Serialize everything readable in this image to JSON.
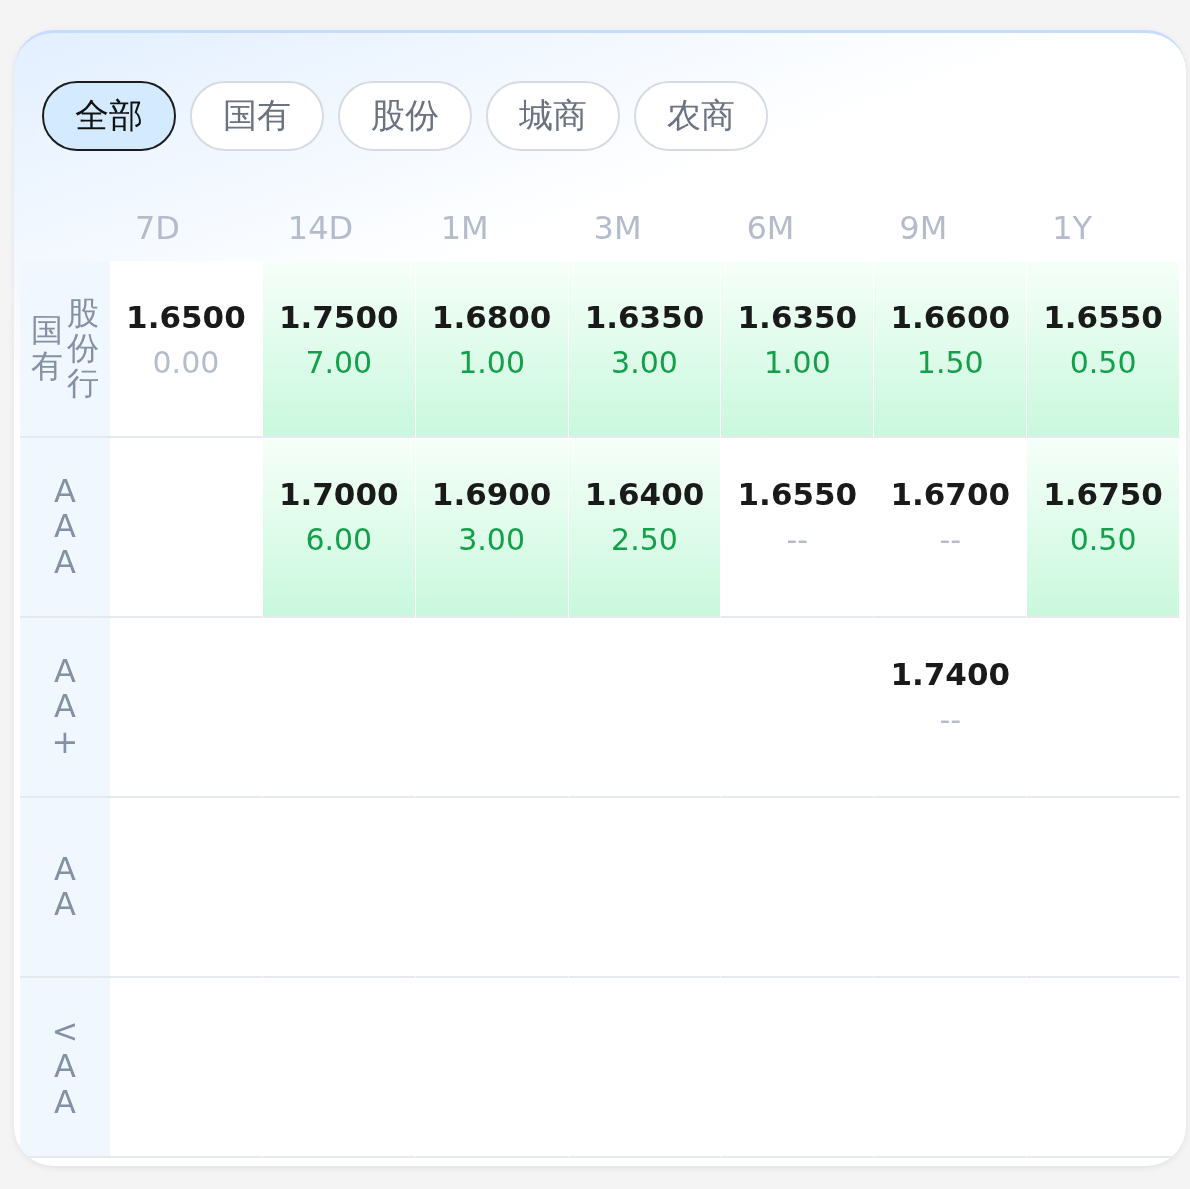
{
  "tabs": [
    {
      "label": "全部",
      "selected": true
    },
    {
      "label": "国有",
      "selected": false
    },
    {
      "label": "股份",
      "selected": false
    },
    {
      "label": "城商",
      "selected": false
    },
    {
      "label": "农商",
      "selected": false
    }
  ],
  "columns": [
    "7D",
    "14D",
    "1M",
    "3M",
    "6M",
    "9M",
    "1Y"
  ],
  "rows": [
    {
      "label": [
        "国有",
        "股份行"
      ],
      "cells": [
        {
          "value": "1.6500",
          "change": "0.00",
          "rising": false,
          "highlighted": false
        },
        {
          "value": "1.7500",
          "change": "7.00",
          "rising": true,
          "highlighted": true
        },
        {
          "value": "1.6800",
          "change": "1.00",
          "rising": true,
          "highlighted": true
        },
        {
          "value": "1.6350",
          "change": "3.00",
          "rising": true,
          "highlighted": true
        },
        {
          "value": "1.6350",
          "change": "1.00",
          "rising": true,
          "highlighted": true
        },
        {
          "value": "1.6600",
          "change": "1.50",
          "rising": true,
          "highlighted": true
        },
        {
          "value": "1.6550",
          "change": "0.50",
          "rising": true,
          "highlighted": true
        }
      ]
    },
    {
      "label": [
        "AAA"
      ],
      "cells": [
        null,
        {
          "value": "1.7000",
          "change": "6.00",
          "rising": true,
          "highlighted": true
        },
        {
          "value": "1.6900",
          "change": "3.00",
          "rising": true,
          "highlighted": true
        },
        {
          "value": "1.6400",
          "change": "2.50",
          "rising": true,
          "highlighted": true
        },
        {
          "value": "1.6550",
          "change": "--",
          "rising": false,
          "highlighted": false
        },
        {
          "value": "1.6700",
          "change": "--",
          "rising": false,
          "highlighted": false
        },
        {
          "value": "1.6750",
          "change": "0.50",
          "rising": true,
          "highlighted": true
        }
      ]
    },
    {
      "label": [
        "AA+"
      ],
      "cells": [
        null,
        null,
        null,
        null,
        null,
        {
          "value": "1.7400",
          "change": "--",
          "rising": false,
          "highlighted": false
        },
        null
      ]
    },
    {
      "label": [
        "AA"
      ],
      "cells": [
        null,
        null,
        null,
        null,
        null,
        null,
        null
      ]
    },
    {
      "label": [
        "<AA"
      ],
      "cells": [
        null,
        null,
        null,
        null,
        null,
        null,
        null
      ]
    }
  ]
}
